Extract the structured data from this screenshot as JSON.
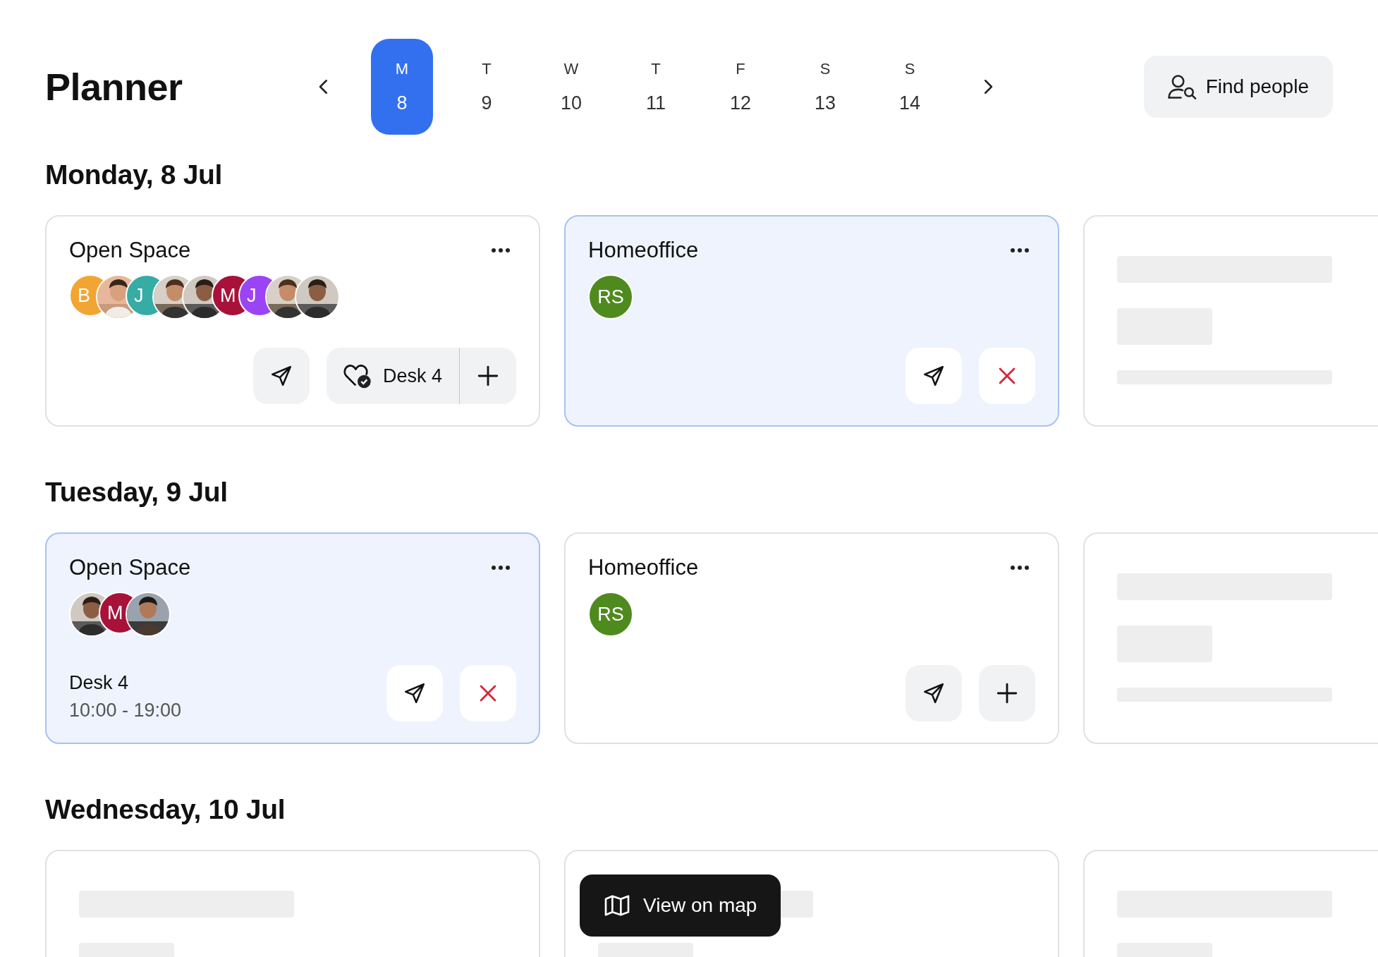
{
  "title": "Planner",
  "days": [
    {
      "letter": "M",
      "date": "8",
      "selected": true
    },
    {
      "letter": "T",
      "date": "9",
      "selected": false
    },
    {
      "letter": "W",
      "date": "10",
      "selected": false
    },
    {
      "letter": "T",
      "date": "11",
      "selected": false
    },
    {
      "letter": "F",
      "date": "12",
      "selected": false
    },
    {
      "letter": "S",
      "date": "13",
      "selected": false
    },
    {
      "letter": "S",
      "date": "14",
      "selected": false
    }
  ],
  "find_people": "Find people",
  "sections": [
    {
      "heading": "Monday, 8 Jul",
      "cards": [
        {
          "kind": "space",
          "name": "Open Space",
          "selected": false,
          "avatars": [
            {
              "kind": "initials",
              "text": "B",
              "color": "#f2a533"
            },
            {
              "kind": "picture"
            },
            {
              "kind": "initials",
              "text": "J",
              "color": "#36aca4"
            },
            {
              "kind": "picture"
            },
            {
              "kind": "picture"
            },
            {
              "kind": "initials",
              "text": "M",
              "color": "#a8123a"
            },
            {
              "kind": "initials",
              "text": "J",
              "color": "#9b44f5"
            },
            {
              "kind": "picture"
            },
            {
              "kind": "picture"
            }
          ],
          "actions": [
            {
              "kind": "send"
            },
            {
              "kind": "desk",
              "label": "Desk 4"
            }
          ]
        },
        {
          "kind": "space",
          "name": "Homeoffice",
          "selected": true,
          "avatars": [
            {
              "kind": "initials",
              "text": "RS",
              "color": "#4f8a1f"
            }
          ],
          "actions": [
            {
              "kind": "send"
            },
            {
              "kind": "cancel"
            }
          ]
        },
        {
          "kind": "skeleton"
        }
      ]
    },
    {
      "heading": "Tuesday, 9 Jul",
      "cards": [
        {
          "kind": "space",
          "name": "Open Space",
          "selected": true,
          "avatars": [
            {
              "kind": "picture"
            },
            {
              "kind": "initials",
              "text": "M",
              "color": "#a8123a"
            },
            {
              "kind": "picture"
            }
          ],
          "desk": "Desk 4",
          "time": "10:00 - 19:00",
          "actions": [
            {
              "kind": "send"
            },
            {
              "kind": "cancel"
            }
          ]
        },
        {
          "kind": "space",
          "name": "Homeoffice",
          "selected": false,
          "avatars": [
            {
              "kind": "initials",
              "text": "RS",
              "color": "#4f8a1f"
            }
          ],
          "actions": [
            {
              "kind": "send"
            },
            {
              "kind": "add"
            }
          ]
        },
        {
          "kind": "skeleton"
        }
      ]
    },
    {
      "heading": "Wednesday, 10 Jul",
      "cards": [
        {
          "kind": "skeleton"
        },
        {
          "kind": "skeleton"
        },
        {
          "kind": "skeleton"
        }
      ]
    }
  ],
  "map_button": "View on map"
}
